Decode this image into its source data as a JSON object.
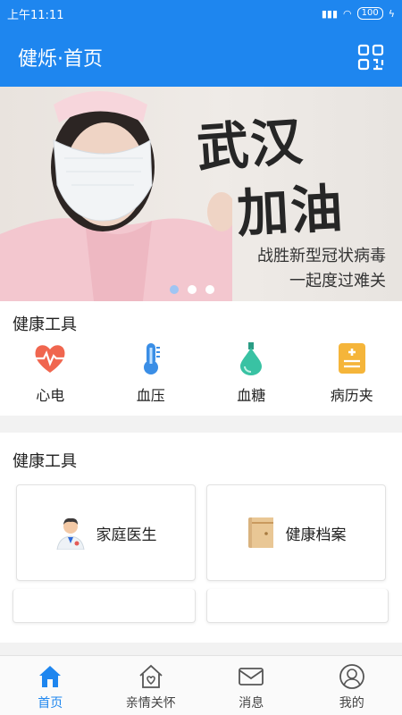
{
  "status_bar": {
    "time": "上午11:11",
    "battery": "100"
  },
  "app_bar": {
    "title": "健烁·首页",
    "qr_icon": "qr-code-icon"
  },
  "banner": {
    "slogan_line1": "武汉",
    "slogan_line2": "加油",
    "subtitle_line1": "战胜新型冠状病毒",
    "subtitle_line2": "一起度过难关",
    "active_dot": 0
  },
  "health_tools": {
    "title": "健康工具",
    "items": [
      {
        "label": "心电",
        "icon": "heart-ecg-icon"
      },
      {
        "label": "血压",
        "icon": "thermometer-icon"
      },
      {
        "label": "血糖",
        "icon": "blood-drop-icon"
      },
      {
        "label": "病历夹",
        "icon": "medical-record-icon"
      }
    ]
  },
  "health_services": {
    "title": "健康工具",
    "cards": [
      {
        "label": "家庭医生",
        "icon": "doctor-icon"
      },
      {
        "label": "健康档案",
        "icon": "archive-folder-icon"
      }
    ]
  },
  "bottom_nav": {
    "items": [
      {
        "label": "首页",
        "icon": "home-icon",
        "active": true
      },
      {
        "label": "亲情关怀",
        "icon": "family-home-icon",
        "active": false
      },
      {
        "label": "消息",
        "icon": "mail-icon",
        "active": false
      },
      {
        "label": "我的",
        "icon": "user-icon",
        "active": false
      }
    ]
  },
  "colors": {
    "primary": "#1e86ef",
    "heart": "#f0664f",
    "thermo": "#3a8ee6",
    "drop": "#39c2a3",
    "record": "#f5b53a"
  }
}
